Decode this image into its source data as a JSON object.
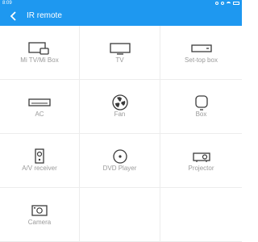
{
  "status_bar": {
    "time": "8:09"
  },
  "app_bar": {
    "title": "IR remote",
    "back_icon": "back-arrow-icon"
  },
  "devices": [
    {
      "label": "Mi TV/Mi Box",
      "icon": "mi-tv-box-icon"
    },
    {
      "label": "TV",
      "icon": "tv-icon"
    },
    {
      "label": "Set-top box",
      "icon": "set-top-box-icon"
    },
    {
      "label": "AC",
      "icon": "ac-icon"
    },
    {
      "label": "Fan",
      "icon": "fan-icon"
    },
    {
      "label": "Box",
      "icon": "box-icon"
    },
    {
      "label": "A/V receiver",
      "icon": "av-receiver-icon"
    },
    {
      "label": "DVD Player",
      "icon": "dvd-player-icon"
    },
    {
      "label": "Projector",
      "icon": "projector-icon"
    },
    {
      "label": "Camera",
      "icon": "camera-icon"
    }
  ],
  "colors": {
    "accent": "#1e98f0",
    "label": "#9a9a9a",
    "icon": "#3a3a3a",
    "divider": "#ececec"
  }
}
